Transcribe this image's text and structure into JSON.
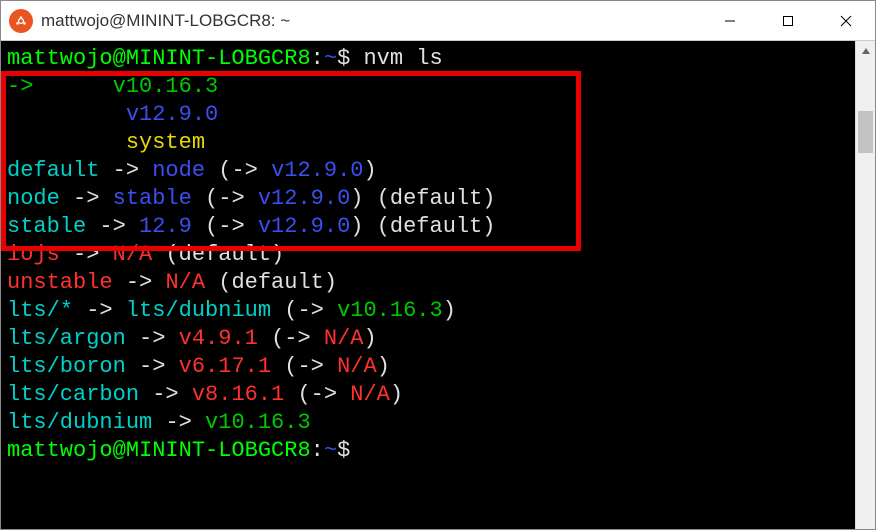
{
  "window": {
    "title": "mattwojo@MININT-LOBGCR8: ~"
  },
  "prompt": {
    "userhost": "mattwojo@MININT-LOBGCR8",
    "colon": ":",
    "path": "~",
    "dollar": "$"
  },
  "cmd": "nvm ls",
  "out": {
    "arrow": "->",
    "v1": "v10.16.3",
    "v2": "v12.9.0",
    "system": "system",
    "default": "default",
    "node": "node",
    "stable": "stable",
    "v129": "12.9",
    "iojs": "iojs",
    "na": "N/A",
    "default_p": "(default)",
    "unstable": "unstable",
    "lts_star": "lts/*",
    "lts_dubnium": "lts/dubnium",
    "lts_argon": "lts/argon",
    "lts_boron": "lts/boron",
    "lts_carbon": "lts/carbon",
    "v491": "v4.9.1",
    "v6171": "v6.17.1",
    "v8161": "v8.16.1",
    "lp": "(",
    "rp": ")",
    "arrow2": "->"
  }
}
